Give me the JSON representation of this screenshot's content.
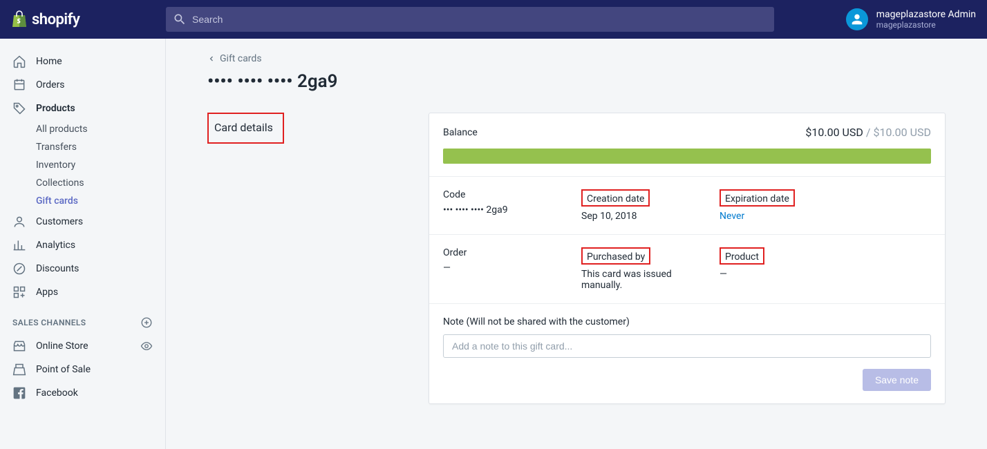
{
  "header": {
    "brand": "shopify",
    "search_placeholder": "Search",
    "account_name": "mageplazastore Admin",
    "account_store": "mageplazastore"
  },
  "sidebar": {
    "items": [
      {
        "label": "Home"
      },
      {
        "label": "Orders"
      },
      {
        "label": "Products"
      }
    ],
    "products_sub": [
      {
        "label": "All products"
      },
      {
        "label": "Transfers"
      },
      {
        "label": "Inventory"
      },
      {
        "label": "Collections"
      },
      {
        "label": "Gift cards"
      }
    ],
    "items2": [
      {
        "label": "Customers"
      },
      {
        "label": "Analytics"
      },
      {
        "label": "Discounts"
      },
      {
        "label": "Apps"
      }
    ],
    "section_head": "SALES CHANNELS",
    "channels": [
      {
        "label": "Online Store"
      },
      {
        "label": "Point of Sale"
      },
      {
        "label": "Facebook"
      }
    ]
  },
  "page": {
    "back_label": "Gift cards",
    "title": "•••• •••• •••• 2ga9",
    "section_title": "Card details"
  },
  "details": {
    "balance_label": "Balance",
    "balance_current": "$10.00 USD",
    "balance_sep": " / ",
    "balance_total": "$10.00 USD",
    "code_label": "Code",
    "code_value": "••• •••• •••• 2ga9",
    "creation_label": "Creation date",
    "creation_value": "Sep 10, 2018",
    "expiration_label": "Expiration date",
    "expiration_value": "Never",
    "order_label": "Order",
    "order_value": "—",
    "purchased_label": "Purchased by",
    "purchased_value": "This card was issued manually.",
    "product_label": "Product",
    "product_value": "—",
    "note_label": "Note (Will not be shared with the customer)",
    "note_placeholder": "Add a note to this gift card...",
    "save_label": "Save note"
  }
}
